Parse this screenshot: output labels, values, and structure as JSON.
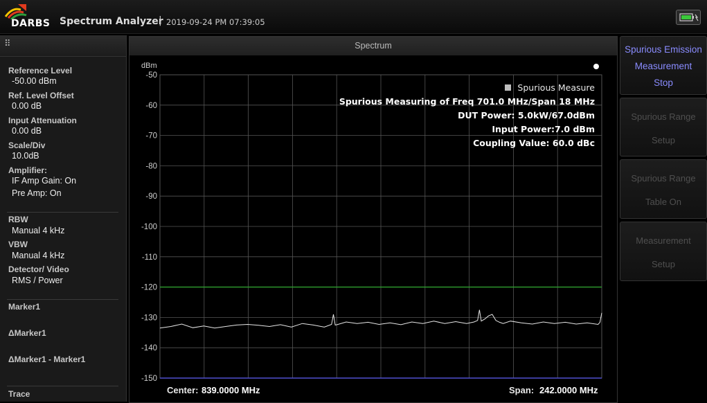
{
  "header": {
    "brand": "DARBS",
    "app_title": "Spectrum Analyzer",
    "separator": "|",
    "datetime": "2019-09-24 PM 07:39:05",
    "battery_icon": "battery-charging-icon"
  },
  "left_panel": {
    "grip_icon": "⠿",
    "params": [
      {
        "label": "Reference Level",
        "value": "-50.00 dBm"
      },
      {
        "label": "Ref. Level Offset",
        "value": "0.00 dB"
      },
      {
        "label": "Input Attenuation",
        "value": "0.00 dB"
      },
      {
        "label": "Scale/Div",
        "value": "10.0dB"
      }
    ],
    "amplifier": {
      "label": "Amplifier:",
      "if_gain": "IF Amp Gain: On",
      "pre_amp": "Pre Amp: On"
    },
    "bandwidth": [
      {
        "label": "RBW",
        "value": "Manual 4 kHz"
      },
      {
        "label": "VBW",
        "value": "Manual 4 kHz"
      },
      {
        "label": "Detector/ Video",
        "value": "RMS / Power"
      }
    ],
    "markers": [
      "Marker1",
      "ΔMarker1",
      "ΔMarker1 - Marker1"
    ],
    "trace_label": "Trace"
  },
  "spectrum": {
    "window_title": "Spectrum",
    "y_unit": "dBm",
    "y_ticks": [
      "-50",
      "-60",
      "-70",
      "-80",
      "-90",
      "-100",
      "-110",
      "-120",
      "-130",
      "-140",
      "-150"
    ],
    "info": {
      "legend": "Spurious Measure",
      "line1": "Spurious Measuring of Freq 701.0 MHz/Span 18 MHz",
      "line2": "DUT Power: 5.0kW/67.0dBm",
      "line3": "Input Power:7.0 dBm",
      "line4": "Coupling Value: 60.0 dBc"
    },
    "center_label": "Center:",
    "center_value": "839.0000 MHz",
    "span_label": "Span:",
    "span_value": "242.0000 MHz",
    "colors": {
      "limit_line": "#2fa02f",
      "trace": "#e8e8e8",
      "grid": "#555555",
      "bottom_line": "#5050d0"
    }
  },
  "chart_data": {
    "type": "line",
    "title": "",
    "xlabel": "",
    "ylabel": "dBm",
    "xlim": [
      718.0,
      960.0
    ],
    "ylim": [
      -150,
      -50
    ],
    "grid": true,
    "series": [
      {
        "name": "",
        "x": [
          718,
          724,
          730,
          736,
          742,
          748,
          754,
          760,
          766,
          772,
          778,
          784,
          790,
          796,
          802,
          808,
          812,
          813,
          814,
          815,
          820,
          826,
          832,
          838,
          844,
          850,
          856,
          862,
          868,
          874,
          880,
          886,
          890,
          892,
          893,
          894,
          896,
          898,
          900,
          901,
          902,
          904,
          906,
          910,
          916,
          922,
          928,
          934,
          940,
          946,
          952,
          958,
          959,
          960
        ],
        "y": [
          -133.5,
          -133.0,
          -132.2,
          -133.4,
          -132.8,
          -133.5,
          -133.0,
          -132.5,
          -132.3,
          -132.6,
          -133.0,
          -132.4,
          -133.2,
          -132.0,
          -132.5,
          -133.2,
          -132.3,
          -129.0,
          -132.5,
          -132.4,
          -131.5,
          -132.0,
          -131.6,
          -132.3,
          -131.8,
          -132.4,
          -131.5,
          -132.0,
          -131.2,
          -132.0,
          -131.4,
          -132.0,
          -131.5,
          -131.0,
          -127.5,
          -131.2,
          -130.5,
          -129.5,
          -129.0,
          -130.0,
          -131.0,
          -131.6,
          -132.0,
          -131.2,
          -131.8,
          -132.2,
          -131.5,
          -132.0,
          -131.6,
          -132.2,
          -131.8,
          -132.3,
          -131.6,
          -128.5
        ]
      },
      {
        "name": "",
        "x": [
          718,
          960
        ],
        "y": [
          -120,
          -120
        ]
      }
    ]
  }
}
